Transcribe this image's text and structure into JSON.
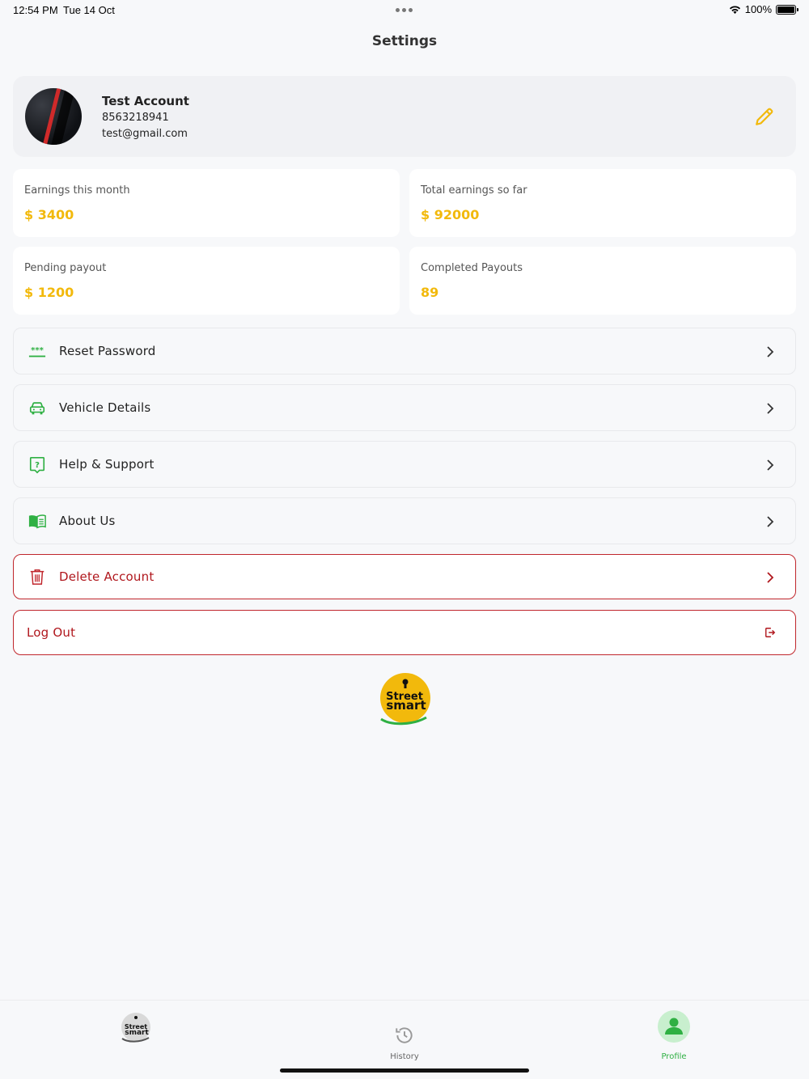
{
  "status_bar": {
    "time": "12:54 PM",
    "date": "Tue 14 Oct",
    "battery": "100%"
  },
  "header": {
    "title": "Settings"
  },
  "profile": {
    "name": "Test Account",
    "phone": "8563218941",
    "email": "test@gmail.com"
  },
  "stats": [
    {
      "label": "Earnings this month",
      "value": "$ 3400"
    },
    {
      "label": "Total earnings so far",
      "value": "$ 92000"
    },
    {
      "label": "Pending payout",
      "value": "$ 1200"
    },
    {
      "label": "Completed Payouts",
      "value": "89"
    }
  ],
  "menu": [
    {
      "label": "Reset Password",
      "icon": "password-icon"
    },
    {
      "label": "Vehicle Details",
      "icon": "car-icon"
    },
    {
      "label": "Help & Support",
      "icon": "help-icon"
    },
    {
      "label": "About Us",
      "icon": "book-icon"
    },
    {
      "label": "Delete Account",
      "icon": "trash-icon"
    },
    {
      "label": "Log Out",
      "icon": "logout-icon"
    }
  ],
  "tabs": [
    {
      "label": "",
      "icon": "street-smart-logo"
    },
    {
      "label": "History",
      "icon": "history-icon"
    },
    {
      "label": "Profile",
      "icon": "profile-icon",
      "active": true
    }
  ],
  "colors": {
    "accent_green": "#2fb043",
    "accent_yellow": "#f2b90c",
    "danger_red": "#c0262c"
  }
}
